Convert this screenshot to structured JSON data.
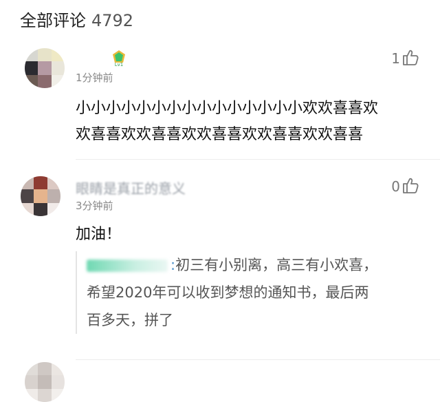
{
  "header": {
    "title": "全部评论",
    "count": "4792"
  },
  "comments": [
    {
      "username": "",
      "badge": "Lv1",
      "time": "1分钟前",
      "likes": "1",
      "text_lines": [
        "小小小小小小小小小小小小小小小欢欢喜喜欢",
        "欢喜喜欢欢喜喜欢欢喜喜欢欢喜喜欢欢喜喜"
      ]
    },
    {
      "username": "眼睛是真正的意义",
      "time": "3分钟前",
      "likes": "0",
      "text": "加油！",
      "quote": {
        "colon": ":",
        "lines": [
          "初三有小别离，高三有小欢喜，",
          "希望2020年可以收到梦想的通知书，最后两",
          "百多天，拼了"
        ]
      }
    }
  ],
  "colors": {
    "badge": "#3cc36b",
    "quote_user": "#6fd8b2",
    "link": "#4a8fc9"
  }
}
